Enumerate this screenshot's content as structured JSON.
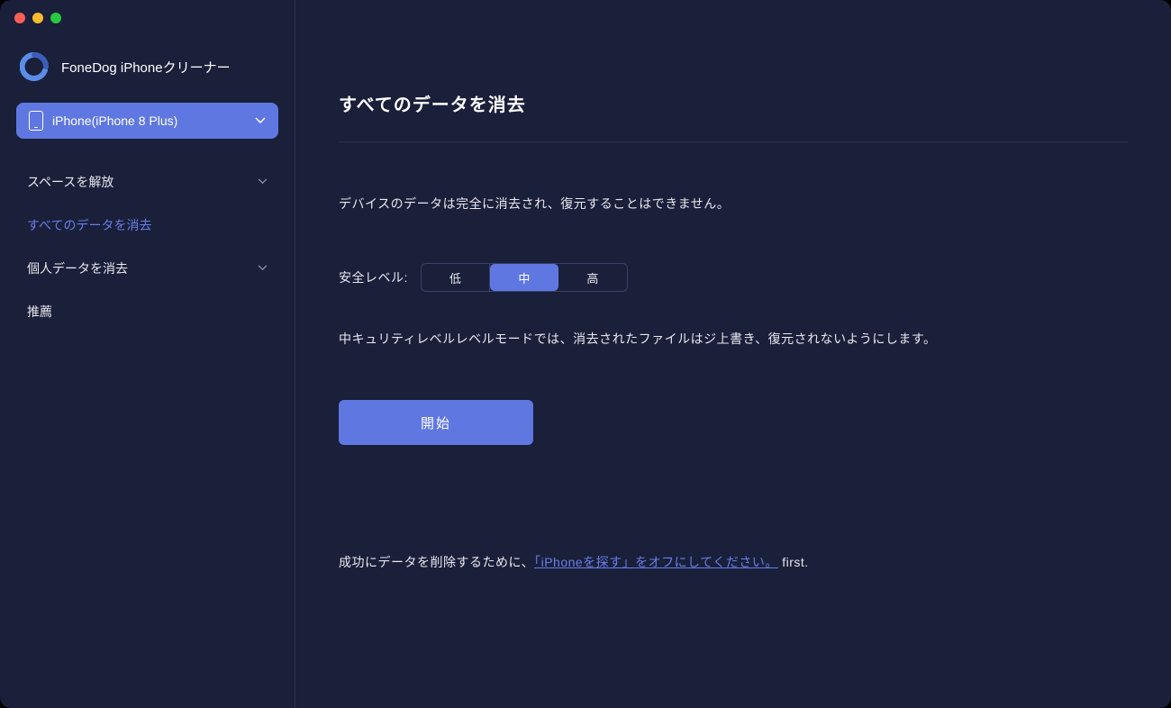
{
  "app": {
    "title": "FoneDog iPhoneクリーナー"
  },
  "device": {
    "label": "iPhone(iPhone 8 Plus)"
  },
  "sidebar": {
    "items": [
      {
        "label": "スペースを解放",
        "has_chevron": true,
        "active": false
      },
      {
        "label": "すべてのデータを消去",
        "has_chevron": false,
        "active": true
      },
      {
        "label": "個人データを消去",
        "has_chevron": true,
        "active": false
      },
      {
        "label": "推薦",
        "has_chevron": false,
        "active": false
      }
    ]
  },
  "main": {
    "title": "すべてのデータを消去",
    "warning": "デバイスのデータは完全に消去され、復元することはできません。",
    "level_label": "安全レベル:",
    "levels": {
      "low": "低",
      "mid": "中",
      "high": "高",
      "selected": "mid"
    },
    "level_description": "中キュリティレベルレベルモードでは、消去されたファイルはジ上書き、復元されないようにします。",
    "start_button": "開始",
    "bottom_note_prefix": "成功にデータを削除するために、",
    "bottom_note_link": "「iPhoneを探す」をオフにしてください。",
    "bottom_note_suffix": " first."
  }
}
